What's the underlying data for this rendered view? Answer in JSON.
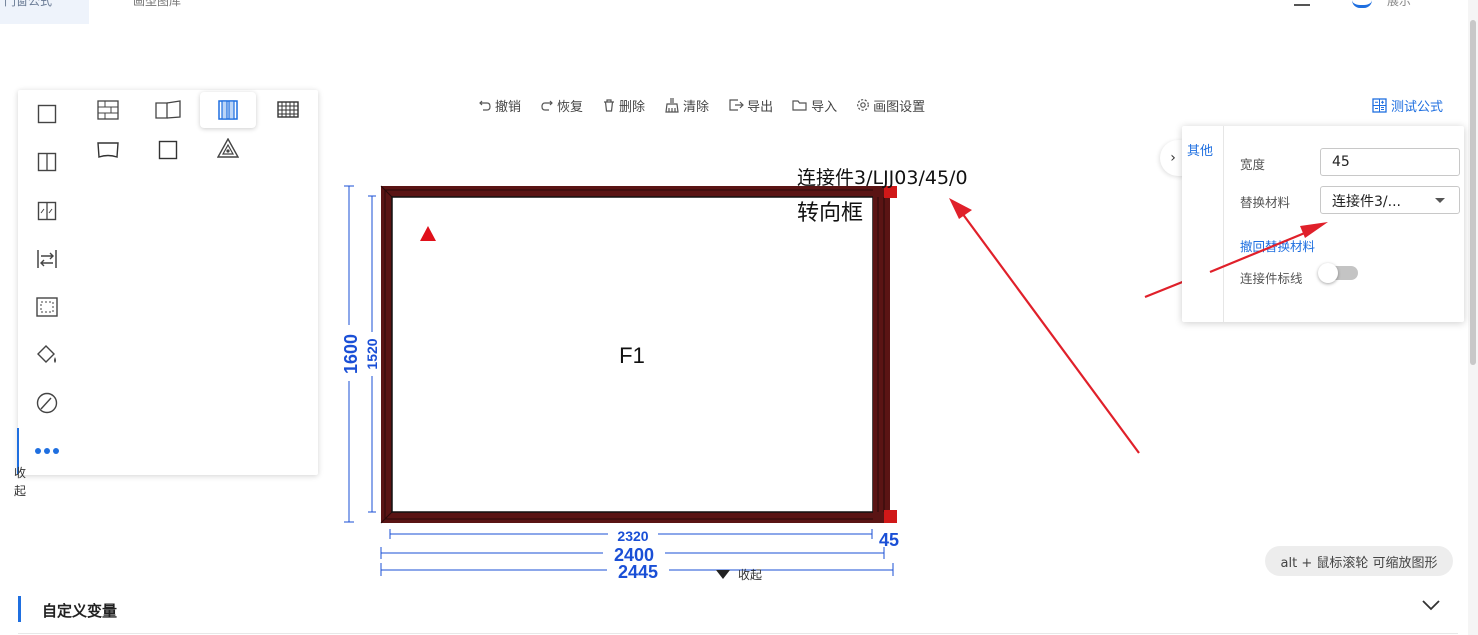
{
  "top": {
    "tab_active": "门窗公式",
    "tab_other": "画型图库",
    "user_label": "展示"
  },
  "tools": [
    {
      "icon": "single-square-icon"
    },
    {
      "icon": "brick-wall-icon"
    },
    {
      "icon": "open-book-icon"
    },
    {
      "icon": "double-panel-icon",
      "selected": true
    },
    {
      "icon": "mesh-grid-icon"
    },
    {
      "icon": "two-column-icon"
    },
    {
      "icon": "flag-shape-icon"
    },
    {
      "icon": "square-outline-icon"
    },
    {
      "icon": "warning-triangle-icon"
    },
    {
      "icon": "sliding-panel-icon"
    },
    {
      "icon": "swap-arrows-icon"
    },
    {
      "icon": "frame-dashed-icon"
    },
    {
      "icon": "paint-bucket-icon"
    },
    {
      "icon": "slash-circle-icon"
    },
    {
      "icon": "more-dots-icon"
    }
  ],
  "side_collapse_label": "收起",
  "toolbar": {
    "undo": "撤销",
    "redo": "恢复",
    "delete": "删除",
    "clear": "清除",
    "export": "导出",
    "import": "导入",
    "settings": "画图设置",
    "test_formula": "测试公式"
  },
  "props": {
    "tab": "其他",
    "width_label": "宽度",
    "width_value": "45",
    "material_label": "替换材料",
    "material_value": "连接件3/...",
    "undo_material": "撤回替换材料",
    "connector_line_label": "连接件标线",
    "connector_line_on": false
  },
  "canvas": {
    "connector_label": "连接件3/LJJ03/45/0",
    "turn_frame_label": "转向框",
    "panel_label": "F1",
    "dim_height_outer": "1600",
    "dim_height_inner": "1520",
    "dim_width_inner": "2320",
    "dim_width_frame": "2400",
    "dim_width_total": "2445",
    "dim_connector": "45"
  },
  "zoom_hint": "alt + 鼠标滚轮 可缩放图形",
  "bottom_collapse": "收起",
  "variables_title": "自定义变量",
  "colors": {
    "accent": "#1f6fe0",
    "frame": "#5a1414",
    "annotation_red": "#e0202a",
    "dimension_blue": "#1a4fd6"
  }
}
